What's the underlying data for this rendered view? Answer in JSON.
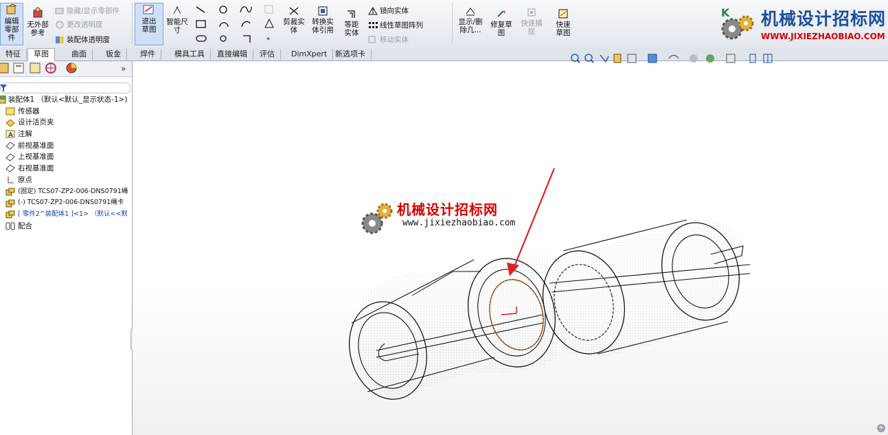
{
  "ribbon": {
    "edit_component": "编辑零部件",
    "no_ext_ref": "无外部参考",
    "hide_show": "隐藏/显示零部件",
    "change_transparency": "更改透明度",
    "assembly_transparency": "装配体透明度",
    "exit_sketch": "退出草图",
    "smart_dim": "智能尺寸",
    "trim_entities": "剪裁实体",
    "convert_entities": "转换实体引用",
    "offset_entities": "等距实体",
    "mirror_entities": "镜向实体",
    "linear_pattern": "线性草图阵列",
    "move_entities": "移动实体",
    "show_delete": "显示/删除几...",
    "repair_sketch": "修复草图",
    "rapid_snap": "快速捕捉",
    "rapid_sketch": "快速草图"
  },
  "logo": {
    "title": "机械设计招标网",
    "url": "WWW.JIXIEZHAOBIAO.COM"
  },
  "tabs": [
    "特征",
    "草图",
    "曲面",
    "钣金",
    "焊件",
    "模具工具",
    "直接编辑",
    "评估",
    "DimXpert",
    "新选项卡"
  ],
  "tree": {
    "root": "装配体1 （默认<默认_显示状态-1>)",
    "items": [
      "传感器",
      "设计活页夹",
      "注解",
      "前视基准面",
      "上视基准面",
      "右视基准面",
      "原点",
      "(固定) TCS07-ZP2-006-DNS0791绳",
      "(-) TCS07-ZP2-006-DNS0791绳卡",
      "[ 零件2^装配体1 ]<1> （默认<<默",
      "配合"
    ]
  },
  "watermark": {
    "title": "机械设计招标网",
    "url": "www.jixiezhaobiao.com"
  },
  "colors": {
    "accent": "#2a5db0",
    "arrow": "#e02020",
    "sketch_circle": "#d2691e",
    "brand_red": "#d40000",
    "brand_blue": "#1a4fa0"
  }
}
